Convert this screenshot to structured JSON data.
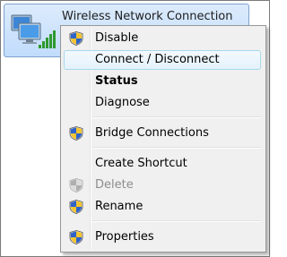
{
  "network_item": {
    "title": "Wireless Network Connection"
  },
  "menu": {
    "items": [
      {
        "label": "Disable",
        "shield": true
      },
      {
        "label": "Connect / Disconnect",
        "shield": false,
        "highlighted": true
      },
      {
        "label": "Status",
        "shield": false,
        "bold": true
      },
      {
        "label": "Diagnose",
        "shield": false
      },
      {
        "label": "Bridge Connections",
        "shield": true
      },
      {
        "label": "Create Shortcut",
        "shield": false
      },
      {
        "label": "Delete",
        "shield": true,
        "disabled": true
      },
      {
        "label": "Rename",
        "shield": true
      },
      {
        "label": "Properties",
        "shield": true
      }
    ]
  },
  "colors": {
    "menu_background": "#f0f0f0",
    "highlight_border": "#a8d8eb",
    "item_selection": "#c1dcfc",
    "disabled_text": "#8d8d8d"
  }
}
